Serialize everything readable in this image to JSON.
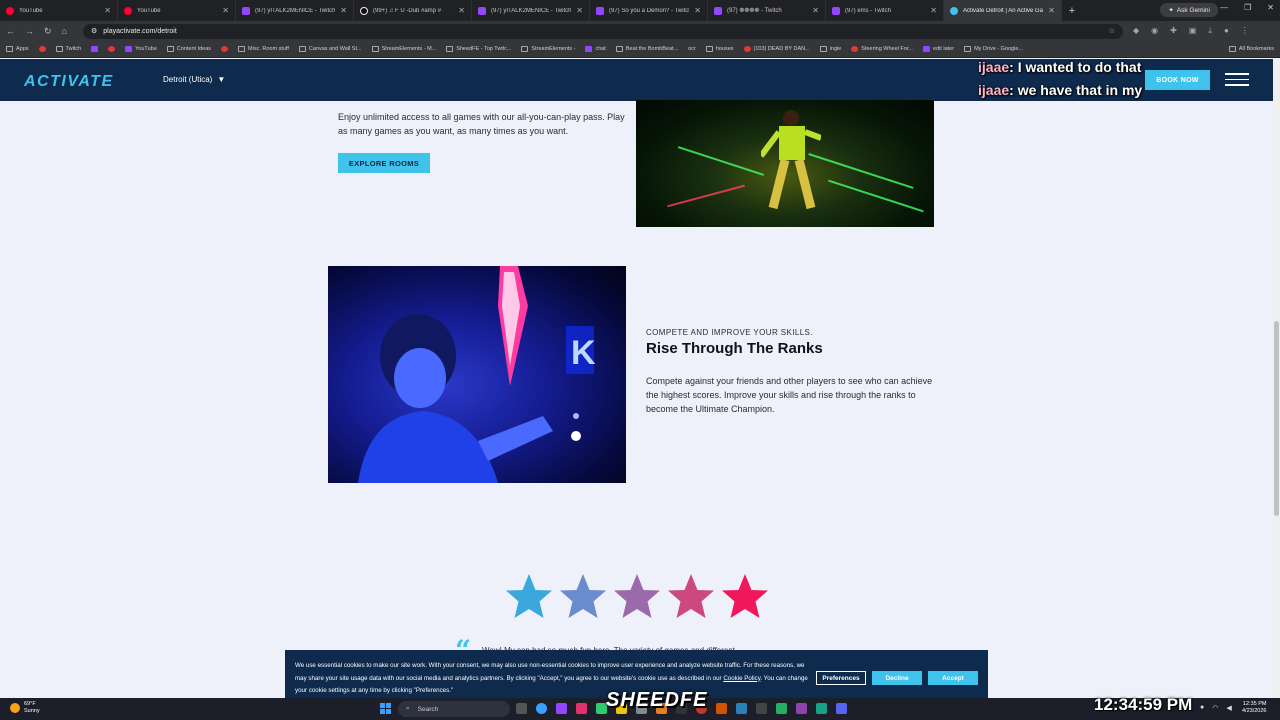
{
  "browser": {
    "tabs": [
      {
        "title": "YouTube",
        "icon": "youtube-icon",
        "active": false
      },
      {
        "title": "YouTube",
        "icon": "youtube-icon",
        "active": false
      },
      {
        "title": "(97) yITALK2MENICE - Twitch",
        "icon": "twitch-icon",
        "active": false
      },
      {
        "title": "(99+) ♫ F U -Dub #amp #",
        "icon": "tiktok-icon",
        "active": false
      },
      {
        "title": "(97) yITALK2MENICE - Twitch",
        "icon": "twitch-icon",
        "active": false
      },
      {
        "title": "(97) So you a Demon? - Twitch",
        "icon": "twitch-icon",
        "active": false
      },
      {
        "title": "(97) ❁❁❁❁ - Twitch",
        "icon": "twitch-icon",
        "active": false
      },
      {
        "title": "(97) ems - Twitch",
        "icon": "twitch-icon",
        "active": false
      },
      {
        "title": "Activate Detroit | An Active Ga",
        "icon": "activate-icon",
        "active": true
      }
    ],
    "ask_gemini": "Ask Gemini",
    "url": "playactivate.com/detroit",
    "bookmarks": [
      "Apps",
      "Twitch",
      "YouTube",
      "Content Ideas",
      "Misc. Room stuff",
      "Canvas and Wall St...",
      "StreamElements - M...",
      "SheedFE - Top Twitc...",
      "StreamElements -",
      "chat",
      "Beat the BombBeat...",
      "ocr",
      "houses",
      "(103) DEAD BY DAN...",
      "ingle",
      "Steering Wheel For...",
      "edit later",
      "My Drive - Google..."
    ],
    "all_bookmarks": "All Bookmarks"
  },
  "site": {
    "logo": "ACTIVATE",
    "location": "Detroit (Utica)",
    "book_now": "BOOK NOW"
  },
  "overlay": {
    "chat": [
      {
        "user": "ijaae",
        "message": "I wanted to do that"
      },
      {
        "user": "ijaae",
        "message": "we have that in my"
      }
    ],
    "streamer_name": "SHEEDFE",
    "big_clock": "12:34:59 PM"
  },
  "content": {
    "intro_text": "Enjoy unlimited access to all games with our all-you-can-play pass. Play as many games as you want, as many times as you want.",
    "explore_button": "EXPLORE ROOMS",
    "kicker": "COMPETE AND IMPROVE YOUR SKILLS.",
    "heading": "Rise Through The Ranks",
    "paragraph": "Compete against your friends and other players to see who can achieve the highest scores. Improve your skills and rise through the ranks to become the Ultimate Champion.",
    "rating": 5,
    "quote_partial": "Wow! My son had so much fun here. The variety of games and different"
  },
  "cookie": {
    "text_1": "We use essential cookies to make our site work. With your consent, we may also use non-essential cookies to improve user experience and analyze website traffic.",
    "text_2": "For these reasons, we may share your site usage data with our social media and analytics partners. By clicking \"Accept,\" you agree to our website's cookie use as",
    "text_3_pre": "described in our",
    "policy_link": "Cookie Policy",
    "text_3_post": ". You can change your cookie settings at any time by clicking \"Preferences.\"",
    "preferences": "Preferences",
    "decline": "Decline",
    "accept": "Accept"
  },
  "taskbar": {
    "weather_temp": "69°F",
    "weather_desc": "Sunny",
    "search": "Search",
    "time": "12:35 PM",
    "date": "4/23/2026"
  },
  "colors": {
    "accent": "#3fc3ec",
    "navy": "#0e2a4d",
    "page_bg": "#eef0fa",
    "star_start": "#3aa8dc",
    "star_end": "#f0185a"
  }
}
